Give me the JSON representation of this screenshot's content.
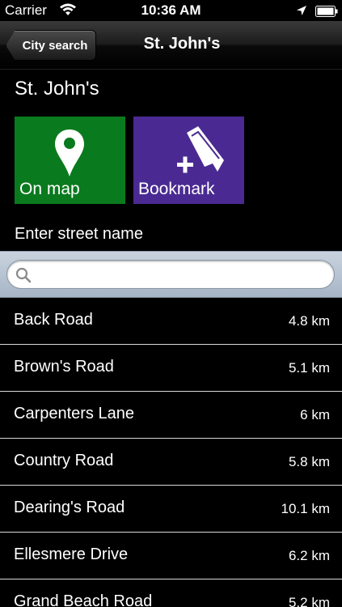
{
  "status_bar": {
    "carrier": "Carrier",
    "time": "10:36 AM"
  },
  "nav": {
    "back_label": "City search",
    "title": "St. John's"
  },
  "city": {
    "name": "St. John's"
  },
  "tiles": {
    "on_map_label": "On map",
    "bookmark_label": "Bookmark",
    "on_map_color": "#0a7a1e",
    "bookmark_color": "#4a2a92"
  },
  "search": {
    "prompt": "Enter street name",
    "value": "",
    "placeholder": ""
  },
  "streets": [
    {
      "name": "Back Road",
      "distance": "4.8 km"
    },
    {
      "name": "Brown's Road",
      "distance": "5.1 km"
    },
    {
      "name": "Carpenters Lane",
      "distance": "6 km"
    },
    {
      "name": "Country Road",
      "distance": "5.8 km"
    },
    {
      "name": "Dearing's Road",
      "distance": "10.1 km"
    },
    {
      "name": "Ellesmere Drive",
      "distance": "6.2 km"
    },
    {
      "name": "Grand Beach Road",
      "distance": "5.2 km"
    }
  ]
}
